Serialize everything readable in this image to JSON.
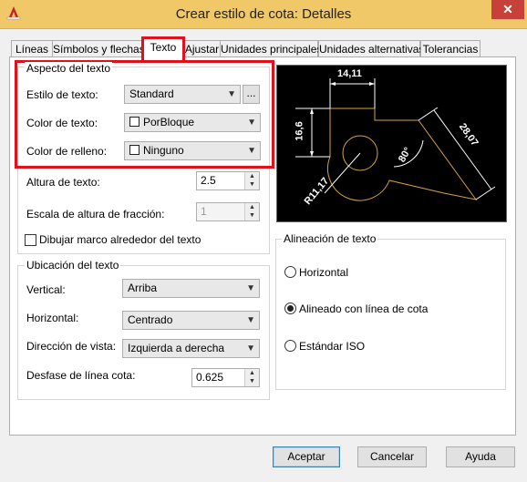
{
  "window": {
    "title": "Crear estilo de cota: Detalles",
    "close_label": "✕"
  },
  "tabs": [
    {
      "label": "Líneas"
    },
    {
      "label": "Símbolos y flechas"
    },
    {
      "label": "Texto"
    },
    {
      "label": "Ajustar"
    },
    {
      "label": "Unidades principales"
    },
    {
      "label": "Unidades alternativas"
    },
    {
      "label": "Tolerancias"
    }
  ],
  "text_appearance": {
    "legend": "Aspecto del texto",
    "style_label": "Estilo de texto:",
    "style_value": "Standard",
    "style_browse": "...",
    "color_label": "Color de texto:",
    "color_value": "PorBloque",
    "fill_label": "Color de relleno:",
    "fill_value": "Ninguno",
    "height_label": "Altura de texto:",
    "height_value": "2.5",
    "fraction_label": "Escala de altura de fracción:",
    "fraction_value": "1",
    "frame_label": "Dibujar marco alrededor del texto"
  },
  "text_placement": {
    "legend": "Ubicación del texto",
    "vertical_label": "Vertical:",
    "vertical_value": "Arriba",
    "horizontal_label": "Horizontal:",
    "horizontal_value": "Centrado",
    "view_dir_label": "Dirección de vista:",
    "view_dir_value": "Izquierda a derecha",
    "offset_label": "Desfase de línea cota:",
    "offset_value": "0.625"
  },
  "text_alignment": {
    "legend": "Alineación de texto",
    "options": [
      {
        "label": "Horizontal",
        "selected": false
      },
      {
        "label": "Alineado con línea de cota",
        "selected": true
      },
      {
        "label": "Estándar ISO",
        "selected": false
      }
    ]
  },
  "preview": {
    "dim_top": "14,11",
    "dim_left": "16,6",
    "dim_right": "28,07",
    "dim_angle": "80°",
    "dim_radius": "R11,17"
  },
  "buttons": {
    "accept": "Aceptar",
    "cancel": "Cancelar",
    "help": "Ayuda"
  },
  "colors": {
    "highlight": "#e0111b",
    "titlebar": "#f0c868",
    "preview_bg": "#000000",
    "preview_line": "#ffffff",
    "preview_geometry": "#d9a33a"
  }
}
